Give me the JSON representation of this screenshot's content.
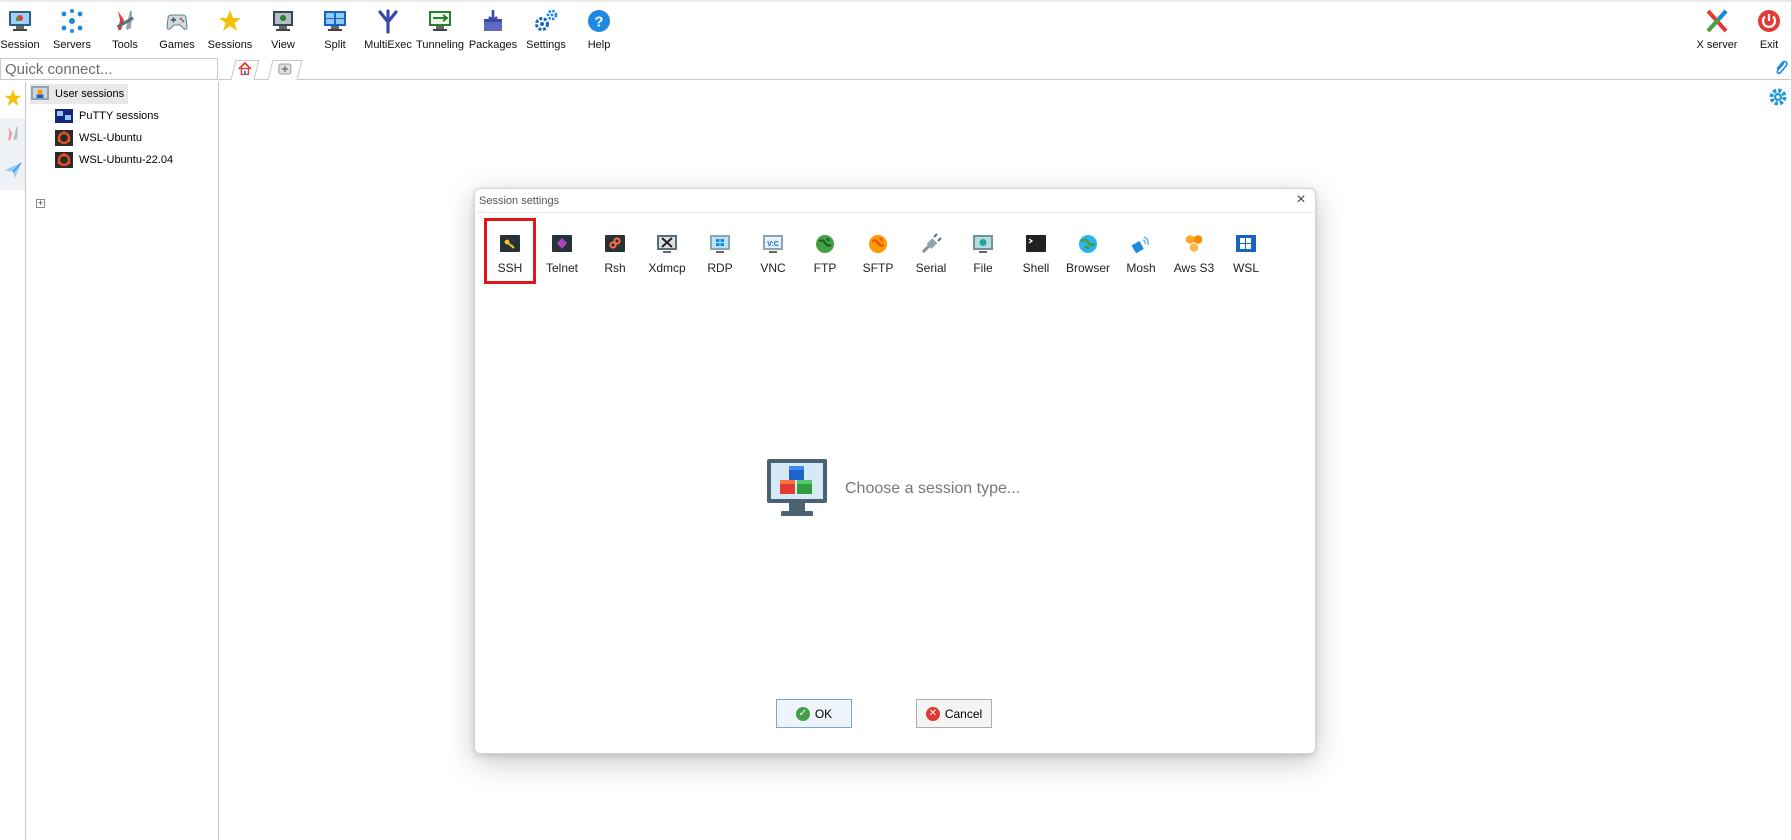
{
  "toolbar": {
    "buttons": [
      {
        "label": "Session",
        "icon": "session-icon"
      },
      {
        "label": "Servers",
        "icon": "servers-icon"
      },
      {
        "label": "Tools",
        "icon": "tools-icon"
      },
      {
        "label": "Games",
        "icon": "games-icon"
      },
      {
        "label": "Sessions",
        "icon": "sessions-star-icon"
      },
      {
        "label": "View",
        "icon": "view-icon"
      },
      {
        "label": "Split",
        "icon": "split-icon"
      },
      {
        "label": "MultiExec",
        "icon": "multiexec-icon"
      },
      {
        "label": "Tunneling",
        "icon": "tunneling-icon"
      },
      {
        "label": "Packages",
        "icon": "packages-icon"
      },
      {
        "label": "Settings",
        "icon": "settings-gears-icon"
      },
      {
        "label": "Help",
        "icon": "help-icon"
      }
    ],
    "right_buttons": [
      {
        "label": "X server",
        "icon": "x-server-icon"
      },
      {
        "label": "Exit",
        "icon": "power-icon"
      }
    ]
  },
  "quick_connect": {
    "placeholder": "Quick connect..."
  },
  "sessions_tree": {
    "root": "User sessions",
    "items": [
      {
        "label": "PuTTY sessions",
        "icon": "putty-icon"
      },
      {
        "label": "WSL-Ubuntu",
        "icon": "ubuntu-icon"
      },
      {
        "label": "WSL-Ubuntu-22.04",
        "icon": "ubuntu-icon"
      }
    ]
  },
  "dialog": {
    "title": "Session settings",
    "session_types": [
      "SSH",
      "Telnet",
      "Rsh",
      "Xdmcp",
      "RDP",
      "VNC",
      "FTP",
      "SFTP",
      "Serial",
      "File",
      "Shell",
      "Browser",
      "Mosh",
      "Aws S3",
      "WSL"
    ],
    "selected": "SSH",
    "prompt": "Choose a session type...",
    "ok_label": "OK",
    "cancel_label": "Cancel"
  },
  "colors": {
    "selection_outline": "#e4141b",
    "accent_blue": "#1e88e5",
    "exit_red": "#e53935"
  }
}
